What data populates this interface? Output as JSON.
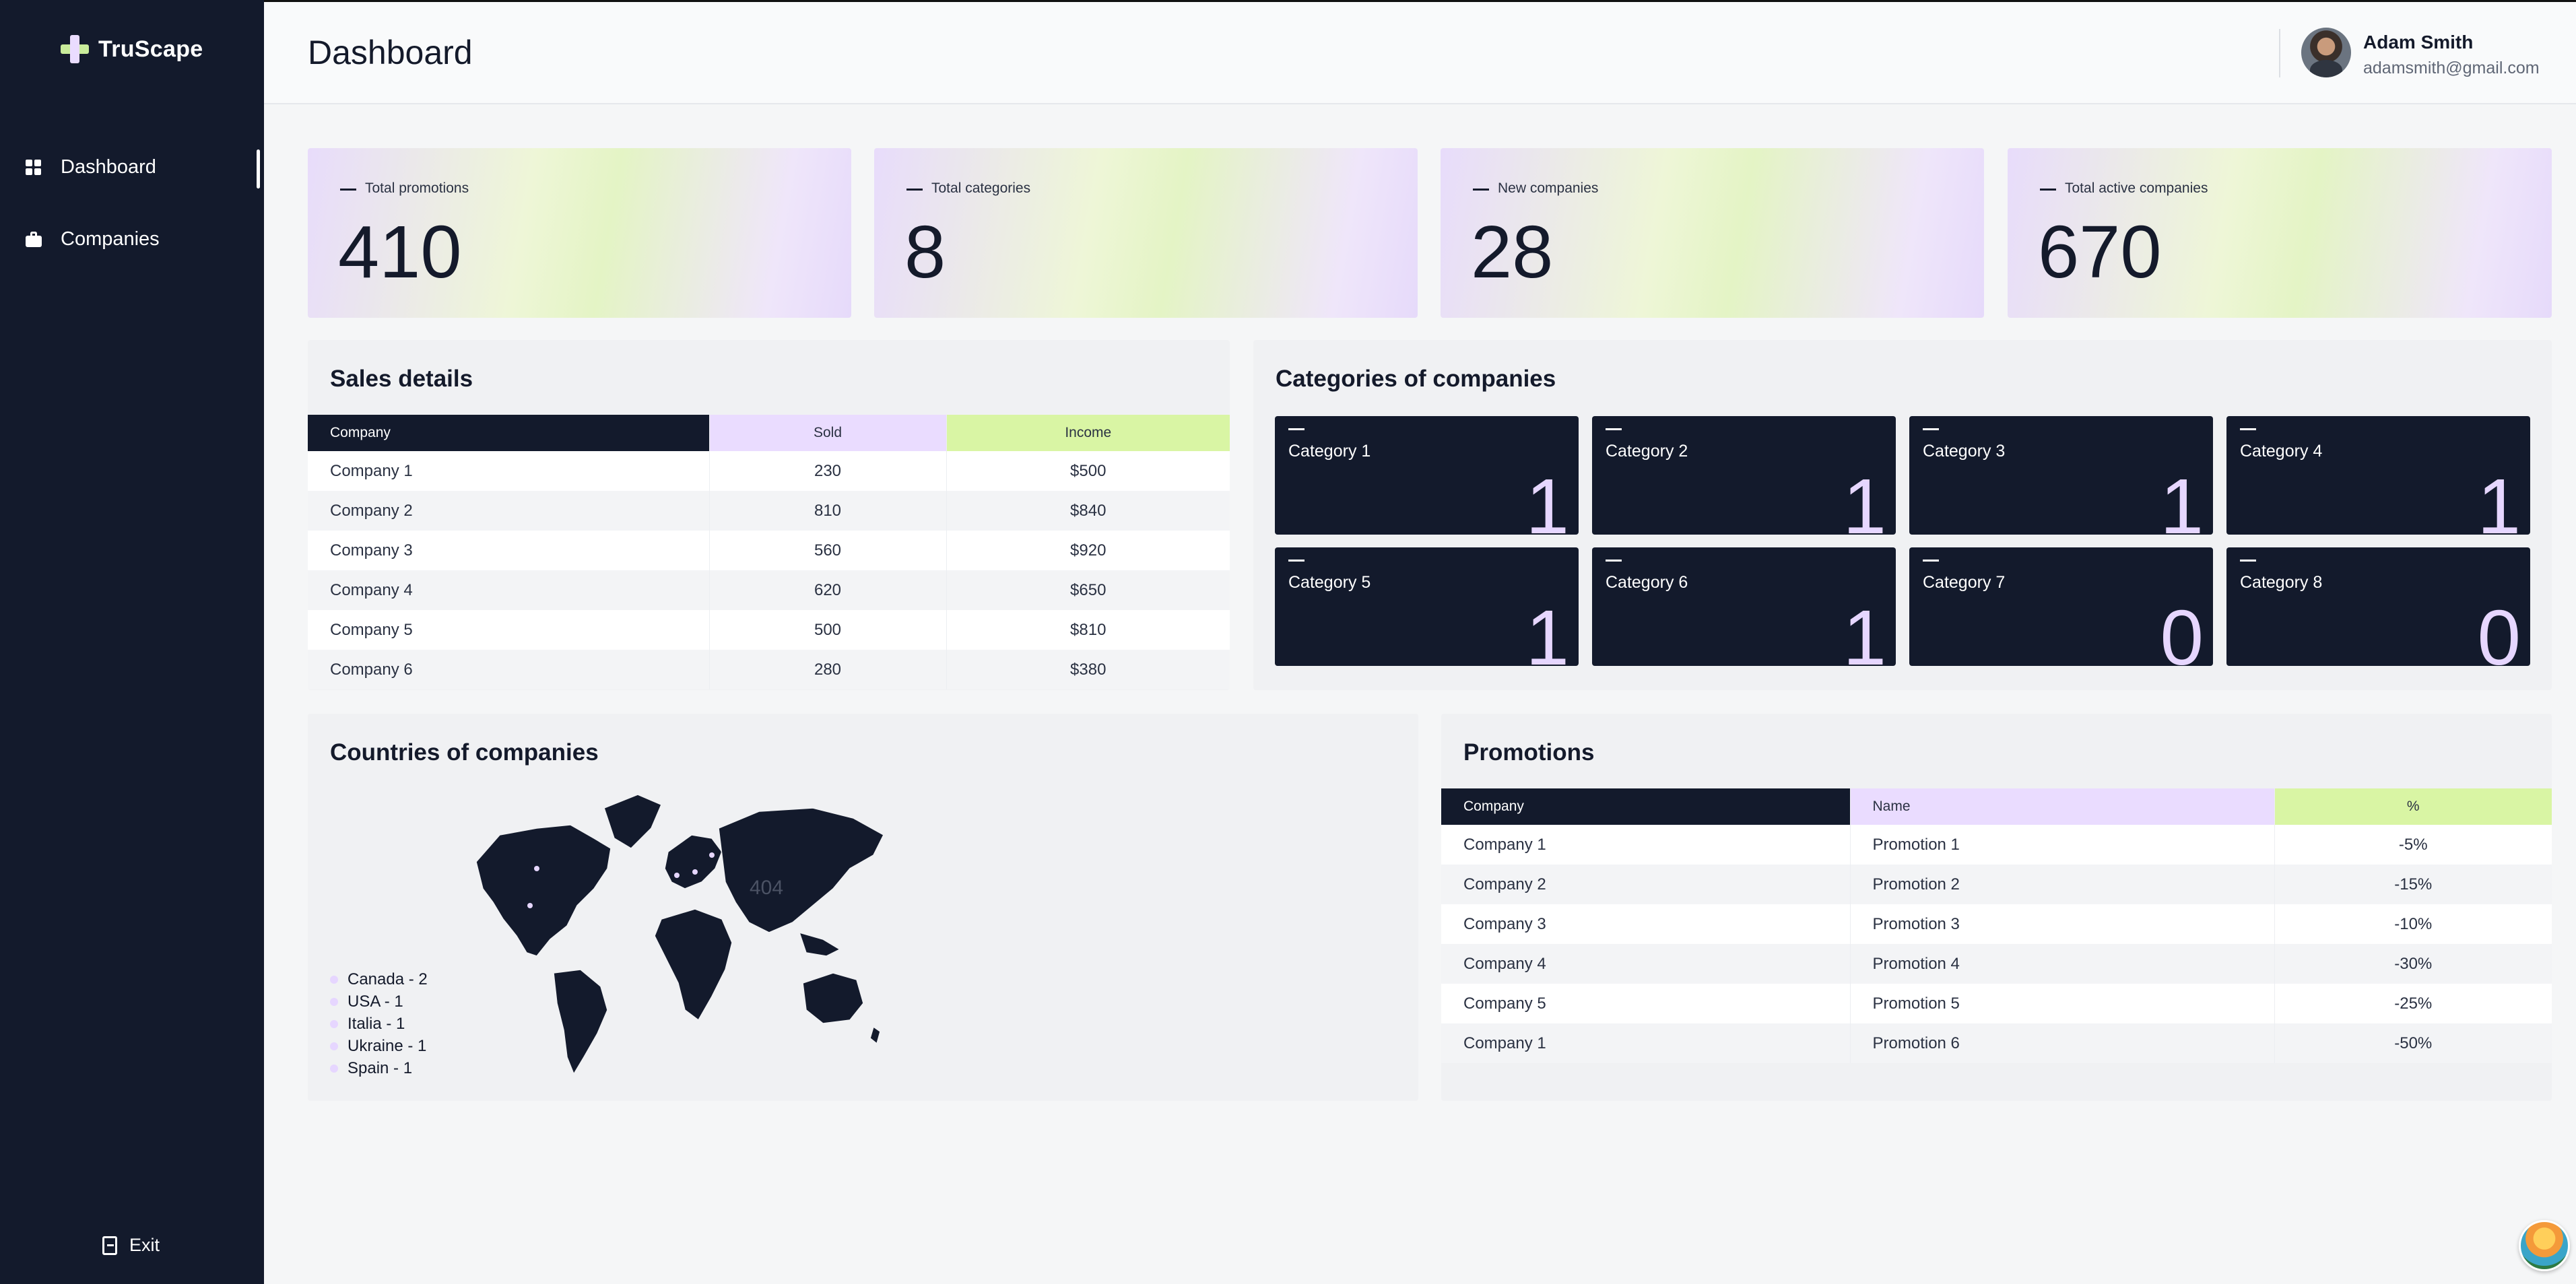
{
  "sidebar": {
    "brand": "TruScape",
    "items": [
      {
        "label": "Dashboard"
      },
      {
        "label": "Companies"
      }
    ],
    "exit_label": "Exit"
  },
  "header": {
    "title": "Dashboard",
    "user": {
      "name": "Adam Smith",
      "email": "adamsmith@gmail.com"
    }
  },
  "stats": [
    {
      "label": "Total promotions",
      "value": "410"
    },
    {
      "label": "Total categories",
      "value": "8"
    },
    {
      "label": "New companies",
      "value": "28"
    },
    {
      "label": "Total active companies",
      "value": "670"
    }
  ],
  "sales": {
    "title": "Sales details",
    "columns": [
      "Company",
      "Sold",
      "Income"
    ],
    "rows": [
      [
        "Company 1",
        "230",
        "$500"
      ],
      [
        "Company 2",
        "810",
        "$840"
      ],
      [
        "Company 3",
        "560",
        "$920"
      ],
      [
        "Company 4",
        "620",
        "$650"
      ],
      [
        "Company 5",
        "500",
        "$810"
      ],
      [
        "Company 6",
        "280",
        "$380"
      ]
    ]
  },
  "categories": {
    "title": "Categories of companies",
    "items": [
      {
        "name": "Category 1",
        "count": "1"
      },
      {
        "name": "Category 2",
        "count": "1"
      },
      {
        "name": "Category 3",
        "count": "1"
      },
      {
        "name": "Category 4",
        "count": "1"
      },
      {
        "name": "Category 5",
        "count": "1"
      },
      {
        "name": "Category 6",
        "count": "1"
      },
      {
        "name": "Category 7",
        "count": "0"
      },
      {
        "name": "Category 8",
        "count": "0"
      }
    ]
  },
  "countries": {
    "title": "Countries of companies",
    "map_overlay_text": "404",
    "legend": [
      "Canada - 2",
      "USA - 1",
      "Italia - 1",
      "Ukraine - 1",
      "Spain - 1"
    ]
  },
  "promotions": {
    "title": "Promotions",
    "columns": [
      "Company",
      "Name",
      "%"
    ],
    "rows": [
      [
        "Company 1",
        "Promotion 1",
        "-5%"
      ],
      [
        "Company 2",
        "Promotion 2",
        "-15%"
      ],
      [
        "Company 3",
        "Promotion 3",
        "-10%"
      ],
      [
        "Company 4",
        "Promotion 4",
        "-30%"
      ],
      [
        "Company 5",
        "Promotion 5",
        "-25%"
      ],
      [
        "Company 1",
        "Promotion 6",
        "-50%"
      ]
    ]
  },
  "colors": {
    "sidebar_bg": "#131a2c",
    "accent_purple": "#eadcff",
    "accent_green": "#d9f5a4"
  }
}
